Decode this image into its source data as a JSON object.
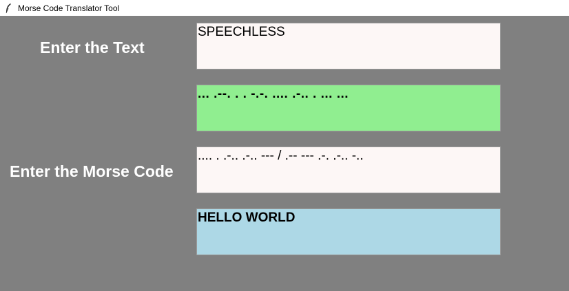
{
  "window": {
    "title": "Morse Code Translator Tool",
    "icon": "feather-icon"
  },
  "text_section": {
    "label": "Enter the Text",
    "input_value": "SPEECHLESS",
    "output_value": "... .--. . . -.-. .... .-.. . ... ..."
  },
  "morse_section": {
    "label": "Enter the Morse Code",
    "input_value": ".... . .-.. .-.. --- / .-- --- .-. .-.. -..",
    "output_value": "HELLO WORLD"
  },
  "colors": {
    "background": "#808080",
    "input_bg": "#fdf7f6",
    "morse_output_bg": "#90ee90",
    "text_output_bg": "#add8e6",
    "label_color": "#ffffff"
  }
}
